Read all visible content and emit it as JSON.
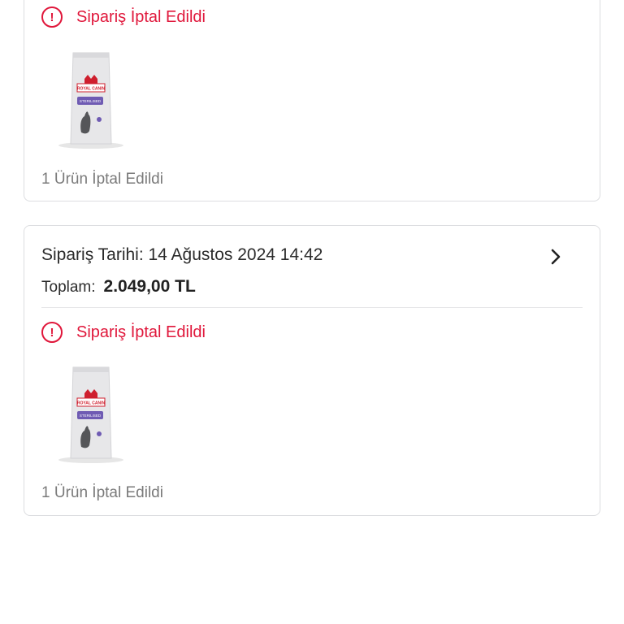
{
  "orders": [
    {
      "status": {
        "icon": "alert-circle-icon",
        "text": "Sipariş İptal Edildi",
        "color": "#e0173b"
      },
      "product": {
        "brand": "ROYAL CANIN",
        "variant": "STERILISED"
      },
      "summary": "1 Ürün İptal Edildi"
    },
    {
      "date_text": "Sipariş Tarihi: 14 Ağustos 2024 14:42",
      "total_label": "Toplam:",
      "total_value": "2.049,00 TL",
      "status": {
        "icon": "alert-circle-icon",
        "text": "Sipariş İptal Edildi",
        "color": "#e0173b"
      },
      "product": {
        "brand": "ROYAL CANIN",
        "variant": "STERILISED"
      },
      "summary": "1 Ürün İptal Edildi",
      "detail_icon": "chevron-right-icon"
    }
  ]
}
